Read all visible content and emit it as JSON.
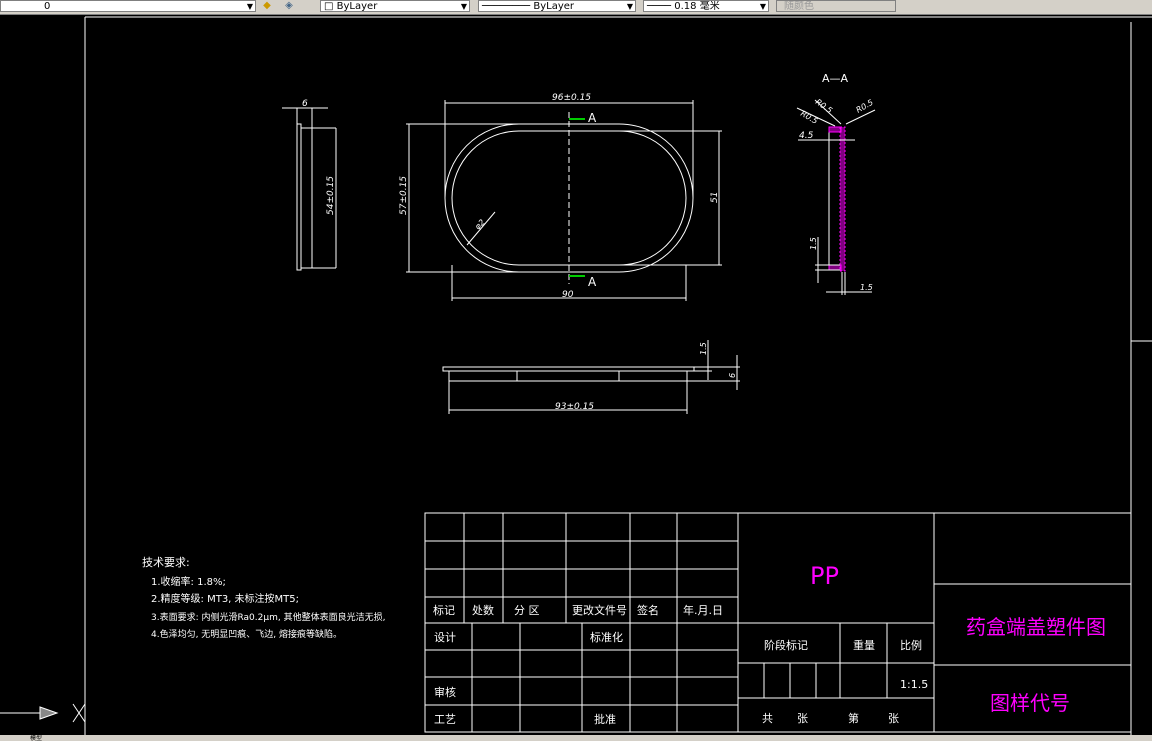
{
  "toolbar": {
    "layer_value": "0",
    "color_value": "ByLayer",
    "linetype_value": "ByLayer",
    "lineweight_value": "0.18 毫米",
    "plotstyle_value": "随颜色"
  },
  "status": {
    "model_tab": "模型"
  },
  "drawing": {
    "side_view": {
      "dim_top": "6",
      "dim_height": "54±0.15"
    },
    "top_view": {
      "dim_width_top": "96±0.15",
      "dim_height_left": "57±0.15",
      "dim_height_right": "51",
      "dim_width_bottom": "90",
      "dim_radius": "φ2",
      "section_mark_top": "A",
      "section_mark_bottom": "A"
    },
    "section_view": {
      "title": "A—A",
      "r1": "R0.5",
      "r2": "R0.5",
      "r3": "R0.5",
      "dim_45": "4.5",
      "dim_15_left": "1.5",
      "dim_15_bottom": "1.5"
    },
    "front_view": {
      "dim_15": "1.5",
      "dim_6": "6",
      "dim_width": "93±0.15"
    }
  },
  "tech_requirements": {
    "title": "技术要求:",
    "items": [
      "1.收缩率: 1.8%;",
      "2.精度等级: MT3, 未标注按MT5;",
      "3.表面要求: 内侧光滑Ra0.2μm, 其他整体表面良光洁无损,",
      "4.色泽均匀, 无明显凹痕、飞边, 熔接痕等缺陷。"
    ]
  },
  "title_block": {
    "header": [
      "标记",
      "处数",
      "分  区",
      "更改文件号",
      "签名",
      "年.月.日"
    ],
    "design": "设计",
    "standardization": "标准化",
    "review": "审核",
    "process": "工艺",
    "approve": "批准",
    "stage_mark": "阶段标记",
    "weight": "重量",
    "scale_label": "比例",
    "scale_value": "1:1.5",
    "sheets": [
      "共",
      "张",
      "第",
      "张"
    ],
    "material": "PP",
    "part_name": "药盒端盖塑件图",
    "drawing_number": "图样代号"
  },
  "colors": {
    "bg": "#000000",
    "line": "#ffffff",
    "magenta": "#ff00ff",
    "green": "#00c000"
  }
}
